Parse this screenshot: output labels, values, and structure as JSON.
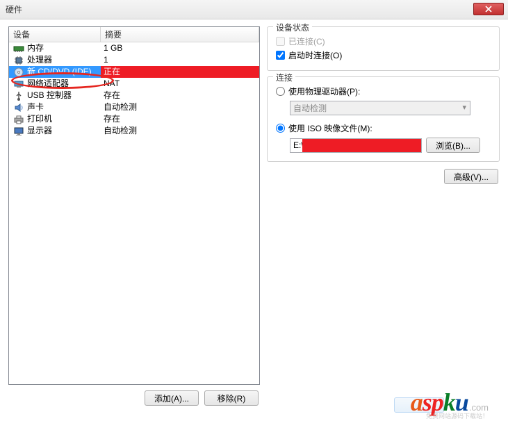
{
  "window": {
    "title": "硬件"
  },
  "list": {
    "header_device": "设备",
    "header_summary": "摘要",
    "rows": [
      {
        "icon": "memory-icon",
        "label": "内存",
        "summary": "1 GB"
      },
      {
        "icon": "cpu-icon",
        "label": "处理器",
        "summary": "1"
      },
      {
        "icon": "cd-icon",
        "label": "新 CD/DVD (IDE)",
        "summary": "正在"
      },
      {
        "icon": "network-icon",
        "label": "网络适配器",
        "summary": "NAT"
      },
      {
        "icon": "usb-icon",
        "label": "USB 控制器",
        "summary": "存在"
      },
      {
        "icon": "sound-icon",
        "label": "声卡",
        "summary": "自动检测"
      },
      {
        "icon": "printer-icon",
        "label": "打印机",
        "summary": "存在"
      },
      {
        "icon": "display-icon",
        "label": "显示器",
        "summary": "自动检测"
      }
    ],
    "selected_index": 2
  },
  "buttons": {
    "add": "添加(A)...",
    "remove": "移除(R)",
    "browse": "浏览(B)...",
    "advanced": "高级(V)..."
  },
  "status_group": {
    "legend": "设备状态",
    "connected": "已连接(C)",
    "connect_at_power": "启动时连接(O)"
  },
  "connection_group": {
    "legend": "连接",
    "use_physical": "使用物理驱动器(P):",
    "physical_value": "自动检测",
    "use_iso": "使用 ISO 映像文件(M):",
    "iso_path": "E:\\"
  },
  "logo": {
    "text": "aspku",
    "suffix": ".com",
    "sub": "免费网站源码下载站！"
  }
}
